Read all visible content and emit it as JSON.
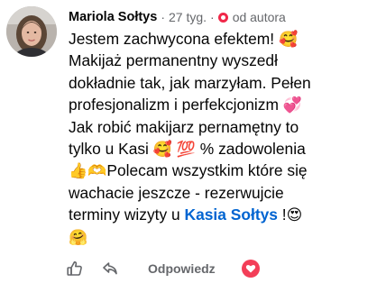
{
  "comment": {
    "author": "Mariola Sołtys",
    "time": "27 tyg.",
    "separator": "·",
    "badge_label": "od autora",
    "lines": [
      {
        "text": "Jestem zachwycona efektem! ",
        "emoji": "🥰"
      },
      {
        "text": "Makijaż permanentny wyszedł"
      },
      {
        "text": "dokładnie tak, jak marzyłam. Pełen"
      },
      {
        "text": "profesjonalizm i perfekcjonizm ",
        "emoji": "💞"
      },
      {
        "text": "Jak robić makijarz pernamętny to"
      },
      {
        "text": "tylko u Kasi ",
        "emoji": "🥰",
        "emoji2": "💯",
        "after": " % zadowolenia"
      },
      {
        "prefix_emoji": "👍🫶",
        "text": "Polecam wszystkim które się"
      },
      {
        "text": "wachacie jeszcze - rezerwujcie"
      },
      {
        "text": "terminy wizyty u ",
        "mention": "Kasia Sołtys",
        "after": " !",
        "emoji": "😍"
      },
      {
        "emoji": "🤗"
      }
    ],
    "actions": {
      "like_icon": "thumbs-up-icon",
      "reply_icon": "reply-arrow-icon",
      "reply_label": "Odpowiedz",
      "love_icon": "heart-icon"
    },
    "colors": {
      "mention": "#0064d1",
      "meta": "#65676b",
      "badge": "#f02849",
      "love": "#f33e58"
    }
  }
}
